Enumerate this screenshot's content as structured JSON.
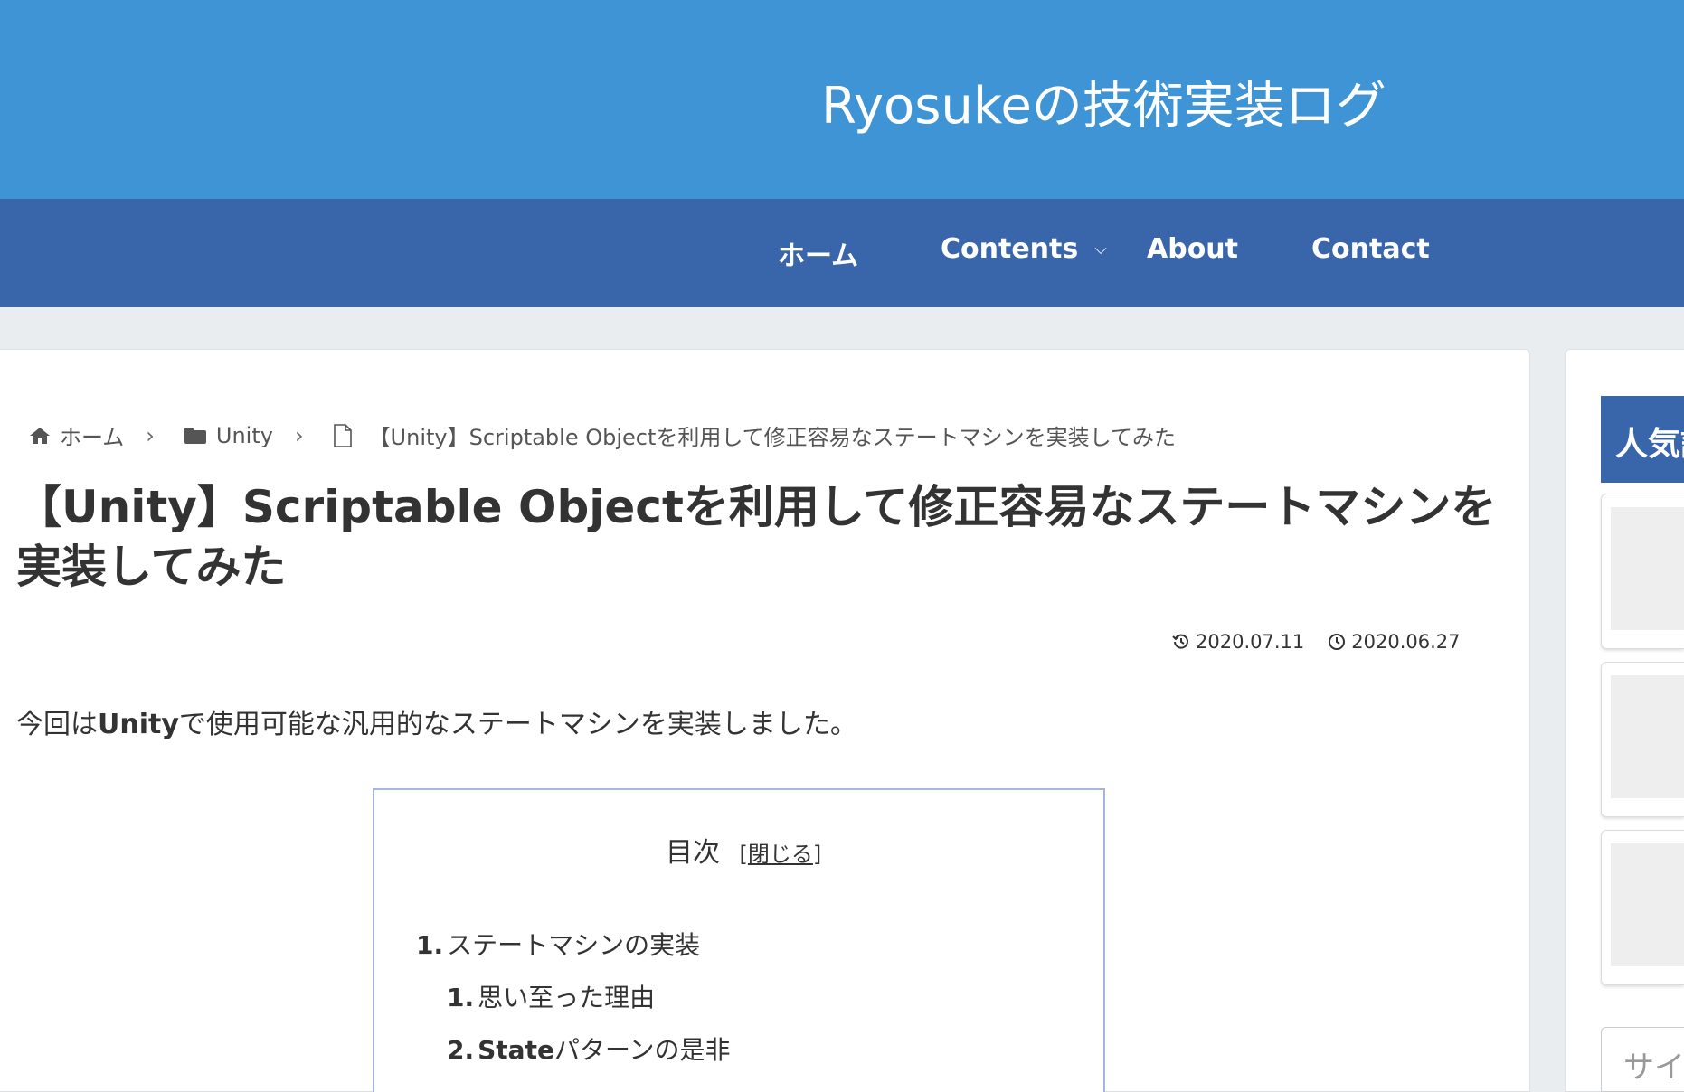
{
  "site": {
    "title": "Ryosukeの技術実装ログ"
  },
  "nav": {
    "home": "ホーム",
    "contents": "Contents",
    "about": "About",
    "contact": "Contact",
    "chevron": "⌵"
  },
  "breadcrumb": {
    "home": "ホーム",
    "category": "Unity",
    "current": "【Unity】Scriptable Objectを利用して修正容易なステートマシンを実装してみた",
    "separator": "›"
  },
  "article": {
    "title": "【Unity】Scriptable Objectを利用して修正容易なステートマシンを実装してみた",
    "updated": "2020.07.11",
    "published": "2020.06.27",
    "intro_prefix": "今回は",
    "intro_bold": "Unity",
    "intro_suffix": "で使用可能な汎用的なステートマシンを実装しました。"
  },
  "toc": {
    "title": "目次",
    "toggle_open": "[",
    "toggle_label": "閉じる",
    "toggle_close": "]",
    "items": [
      {
        "num": "1.",
        "label": "ステートマシンの実装"
      },
      {
        "num": "1.",
        "label": "思い至った理由"
      },
      {
        "num": "2.",
        "label_bold": "State",
        "label": "パターンの是非"
      }
    ]
  },
  "sidebar": {
    "heading": "人気記事",
    "search_placeholder": "サイト内を検索"
  },
  "colors": {
    "header": "#3f94d5",
    "nav": "#3966ab",
    "background": "#e9edf0",
    "toc_border": "#a6b6d9"
  }
}
